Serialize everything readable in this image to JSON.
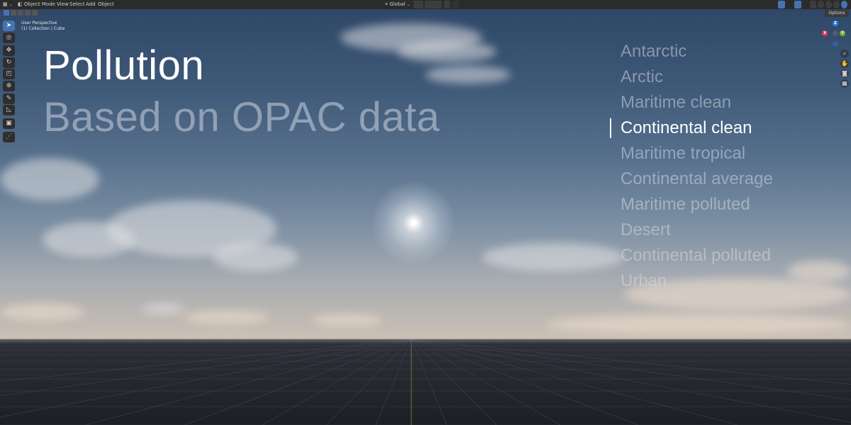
{
  "header": {
    "editor_icon": "viewport-icon",
    "mode_label": "Object Mode",
    "menu": [
      "View",
      "Select",
      "Add",
      "Object"
    ],
    "transform_orientation": "Global",
    "options_label": "Options"
  },
  "viewport": {
    "perspective_label": "User Perspective",
    "collection_label": "(1) Collection | Cube"
  },
  "overlay": {
    "title": "Pollution",
    "subtitle": "Based on OPAC data",
    "presets": [
      {
        "label": "Antarctic",
        "active": false
      },
      {
        "label": "Arctic",
        "active": false
      },
      {
        "label": "Maritime clean",
        "active": false
      },
      {
        "label": "Continental clean",
        "active": true
      },
      {
        "label": "Maritime tropical",
        "active": false
      },
      {
        "label": "Continental average",
        "active": false
      },
      {
        "label": "Maritime polluted",
        "active": false
      },
      {
        "label": "Desert",
        "active": false
      },
      {
        "label": "Continental polluted",
        "active": false
      },
      {
        "label": "Urban",
        "active": false
      }
    ]
  },
  "gizmo": {
    "x_label": "X",
    "y_label": "Y",
    "z_label": "Z",
    "x_color": "#e3344b",
    "y_color": "#7ab22a",
    "z_color": "#2f7ee0"
  },
  "toolbar": {
    "tools": [
      "select-box-icon",
      "cursor-icon",
      "move-icon",
      "rotate-icon",
      "scale-icon",
      "transform-icon",
      "annotate-icon",
      "measure-icon",
      "add-cube-icon",
      "extra-icon"
    ]
  },
  "colors": {
    "accent": "#4772b3",
    "header_bg": "#2b2b2b"
  }
}
